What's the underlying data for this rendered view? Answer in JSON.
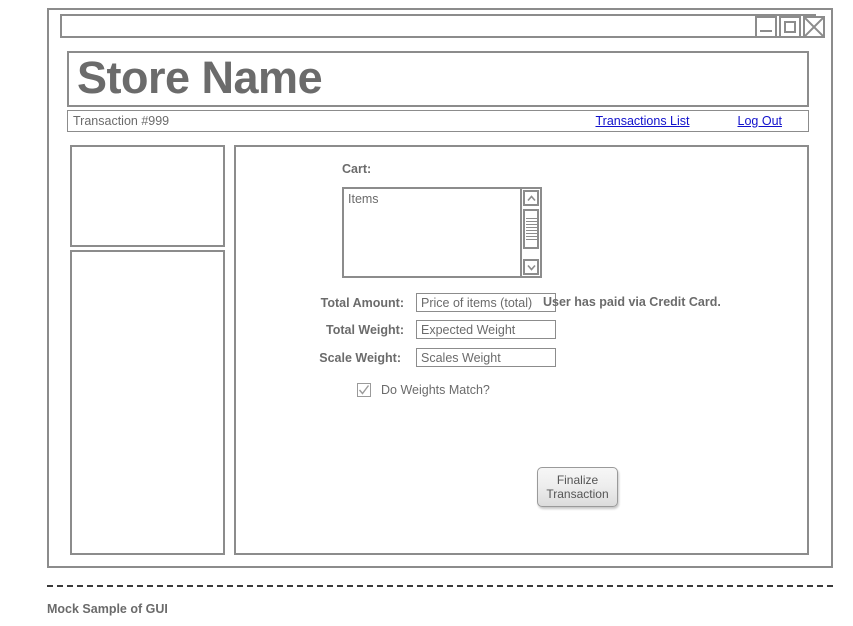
{
  "window": {
    "controls": [
      {
        "name": "minimize",
        "glyph": "minimize-icon"
      },
      {
        "name": "maximize",
        "glyph": "maximize-icon"
      },
      {
        "name": "close",
        "glyph": "close-icon"
      }
    ]
  },
  "header": {
    "store_title": "Store Name",
    "transaction_id": "Transaction #999",
    "links": [
      {
        "label": "Transactions List"
      },
      {
        "label": "Log Out"
      }
    ]
  },
  "cart": {
    "label": "Cart:",
    "items_text": "Items",
    "scrollbar": {
      "up_arrow": "scroll-up-icon",
      "down_arrow": "scroll-down-icon"
    }
  },
  "form": {
    "total_amount": {
      "label": "Total Amount:",
      "value": "Price of items (total)",
      "placeholder": "Price of items (total)"
    },
    "total_weight": {
      "label": "Total Weight:",
      "value": "Expected Weight",
      "placeholder": "Expected Weight"
    },
    "scale_weight": {
      "label": "Scale Weight:",
      "value": "Scales Weight",
      "placeholder": "Scales Weight"
    },
    "payment_note": "User has paid via Credit Card.",
    "weights_match": {
      "label": "Do Weights Match?",
      "checked": true
    }
  },
  "actions": {
    "finalize_line1": "Finalize",
    "finalize_line2": "Transaction"
  },
  "footer": {
    "caption": "Mock Sample of GUI"
  },
  "colors": {
    "border": "#8c8c8c",
    "text": "#6b6b6b",
    "link": "#1111cc",
    "divider": "#3a3a3a"
  }
}
